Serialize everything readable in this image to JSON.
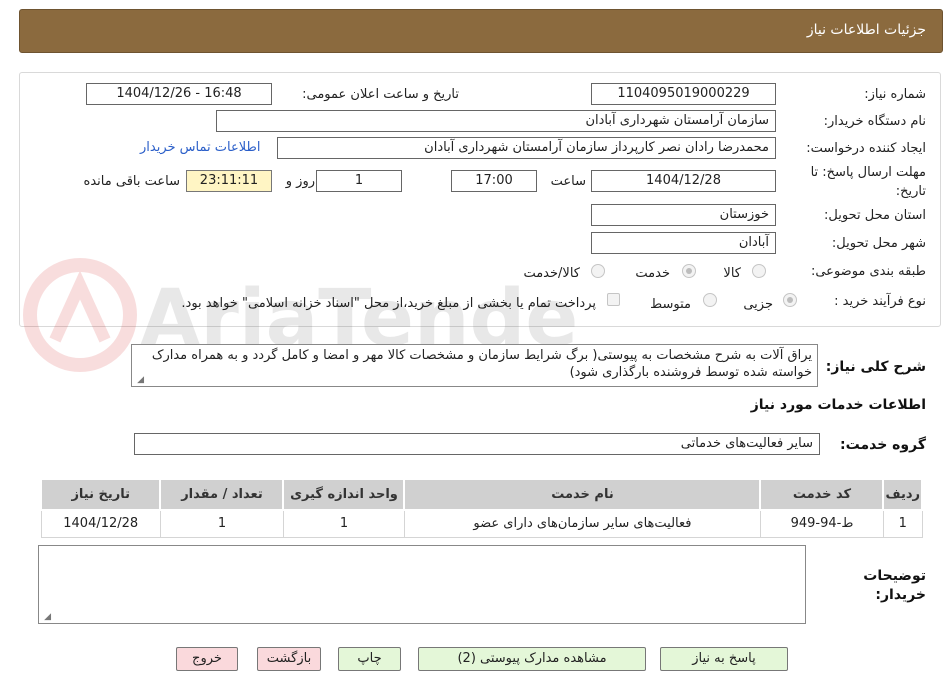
{
  "header": {
    "title": "جزئیات اطلاعات نیاز"
  },
  "form": {
    "need_number_label": "شماره نیاز:",
    "need_number": "1104095019000229",
    "announce_label": "تاریخ و ساعت اعلان عمومی:",
    "announce_value": "1404/12/26 - 16:48",
    "buyer_org_label": "نام دستگاه خریدار:",
    "buyer_org": "سازمان آرامستان شهرداری آبادان",
    "creator_label": "ایجاد کننده درخواست:",
    "creator": "محمدرضا رادان نصر کارپرداز سازمان آرامستان شهرداری آبادان",
    "contact_link": "اطلاعات تماس خریدار",
    "deadline_label_1": "مهلت ارسال پاسخ: تا",
    "deadline_label_2": "تاریخ:",
    "deadline_date": "1404/12/28",
    "time_label": "ساعت",
    "deadline_time": "17:00",
    "days_value": "1",
    "days_label": "روز و",
    "remaining_time": "23:11:11",
    "remaining_label": "ساعت باقی مانده",
    "province_label": "استان محل تحویل:",
    "province": "خوزستان",
    "city_label": "شهر محل تحویل:",
    "city": "آبادان",
    "category_label": "طبقه بندی موضوعی:",
    "category_options": [
      "کالا",
      "خدمت",
      "کالا/خدمت"
    ],
    "category_selected": "خدمت",
    "process_label": "نوع فرآیند خرید :",
    "process_options": [
      "جزیی",
      "متوسط"
    ],
    "process_selected": "جزیی",
    "payment_note": "پرداخت تمام یا بخشی از مبلغ خرید،از محل \"اسناد خزانه اسلامی\" خواهد بود."
  },
  "description": {
    "label": "شرح کلی نیاز:",
    "text": "یراق آلات به شرح مشخصات به پیوستی( برگ شرایط سازمان و مشخصات کالا مهر و امضا و کامل گردد و به همراه مدارک خواسته شده توسط فروشنده بارگذاری شود)"
  },
  "services": {
    "section_title": "اطلاعات خدمات مورد نیاز",
    "group_label": "گروه خدمت:",
    "group_value": "سایر فعالیت‌های خدماتی",
    "columns": [
      "ردیف",
      "کد خدمت",
      "نام خدمت",
      "واحد اندازه گیری",
      "تعداد / مقدار",
      "تاریخ نیاز"
    ],
    "rows": [
      [
        "1",
        "ط-94-949",
        "فعالیت‌های سایر سازمان‌های دارای عضو",
        "1",
        "1",
        "1404/12/28"
      ]
    ]
  },
  "buyer_notes": {
    "label_1": "توضیحات",
    "label_2": "خریدار:",
    "value": ""
  },
  "buttons": {
    "reply": "پاسخ به نیاز",
    "attachments": "مشاهده مدارک پیوستی (2)",
    "print": "چاپ",
    "back": "بازگشت",
    "exit": "خروج"
  },
  "watermark": {
    "text": "AriaTender.neT"
  },
  "colors": {
    "header_bg": "#8b6a3e",
    "link": "#2b5fc9",
    "time_bg": "#fff5c4",
    "green_btn": "#e4f7d8",
    "pink_btn": "#fad9dc"
  }
}
